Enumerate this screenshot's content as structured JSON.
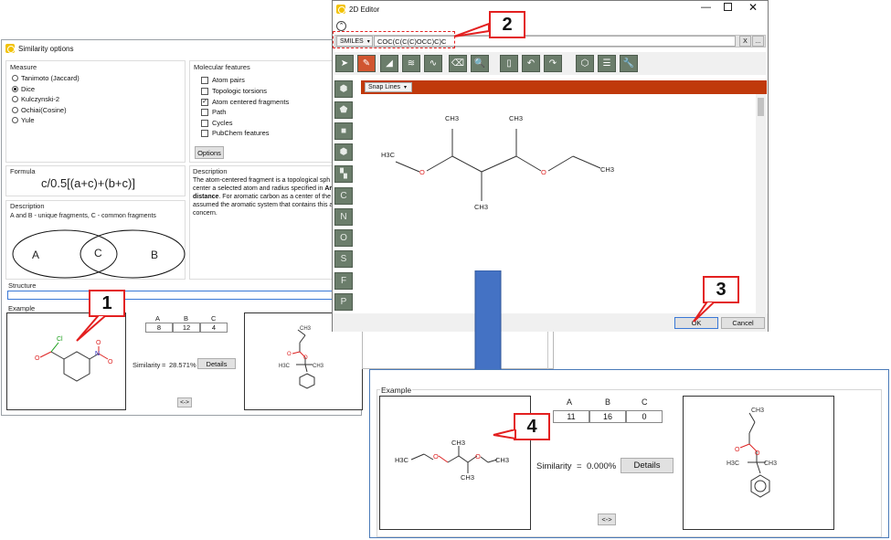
{
  "similarity_window": {
    "title": "Similarity options",
    "measure": {
      "label": "Measure",
      "options": [
        "Tanimoto (Jaccard)",
        "Dice",
        "Kulczynski-2",
        "Ochiai(Cosine)",
        "Yule"
      ],
      "selected": "Dice"
    },
    "features": {
      "label": "Molecular features",
      "items": [
        {
          "label": "Atom pairs",
          "checked": false
        },
        {
          "label": "Topologic torsions",
          "checked": false
        },
        {
          "label": "Atom centered fragments",
          "checked": true
        },
        {
          "label": "Path",
          "checked": false
        },
        {
          "label": "Cycles",
          "checked": false
        },
        {
          "label": "PubChem features",
          "checked": false
        }
      ],
      "options_button": "Options"
    },
    "formula": {
      "label": "Formula",
      "text": "c/0.5[(a+c)+(b+c)]"
    },
    "description_left": {
      "label": "Description",
      "text": "A and B - unique fragments, C - common fragments",
      "venn": {
        "a": "A",
        "b": "B",
        "c": "C"
      }
    },
    "description_right": {
      "label": "Description",
      "line1": "The atom-centered fragment is a topological sph",
      "line2": "center a selected atom and radius specified in",
      "line2_bold": "Ar",
      "line3_bold": "distance",
      "line3": ". For aromatic carbon as a center of the",
      "line4": "assumed the aromatic system that contains this a",
      "line5": "concern."
    },
    "structure_label": "Structure",
    "example": {
      "label": "Example",
      "headers": [
        "A",
        "B",
        "C"
      ],
      "values": [
        "8",
        "12",
        "4"
      ],
      "similarity_label": "Similarity",
      "equals": "=",
      "similarity_value": "28.571%",
      "details_button": "Details",
      "swap_button": "<->"
    }
  },
  "editor_window": {
    "title": "2D Editor",
    "format": "SMILES",
    "smiles": "COC(C(C(C)OCC)C)C",
    "clear_button": "X",
    "more_button": "...",
    "snap_lines": "Snap Lines",
    "atoms": [
      "C",
      "N",
      "O",
      "S",
      "F",
      "P"
    ],
    "molecule_labels": {
      "ch3_top_left": "CH3",
      "ch3_top_right": "CH3",
      "h3c_left": "H3C",
      "o_left": "O",
      "o_right": "O",
      "ch3_right": "CH3",
      "ch3_bottom": "CH3"
    },
    "ok_button": "OK",
    "cancel_button": "Cancel"
  },
  "result_panel": {
    "example_label": "Example",
    "headers": [
      "A",
      "B",
      "C"
    ],
    "values": [
      "11",
      "16",
      "0"
    ],
    "similarity_label": "Similarity",
    "equals": "=",
    "similarity_value": "0.000%",
    "details_button": "Details",
    "swap_button": "<->",
    "molecule_labels": {
      "h3c": "H3C",
      "o1": "O",
      "ch3_top": "CH3",
      "ch3_bottom": "CH3",
      "o2": "O",
      "ch3_right": "CH3"
    }
  },
  "callouts": [
    "1",
    "2",
    "3",
    "4"
  ],
  "colors": {
    "accent_red": "#e32020",
    "arrow_blue": "#4472c4",
    "toolbar_green": "#6b7d6b",
    "canvas_header": "#c0390b",
    "result_border": "#4a7ab8"
  }
}
